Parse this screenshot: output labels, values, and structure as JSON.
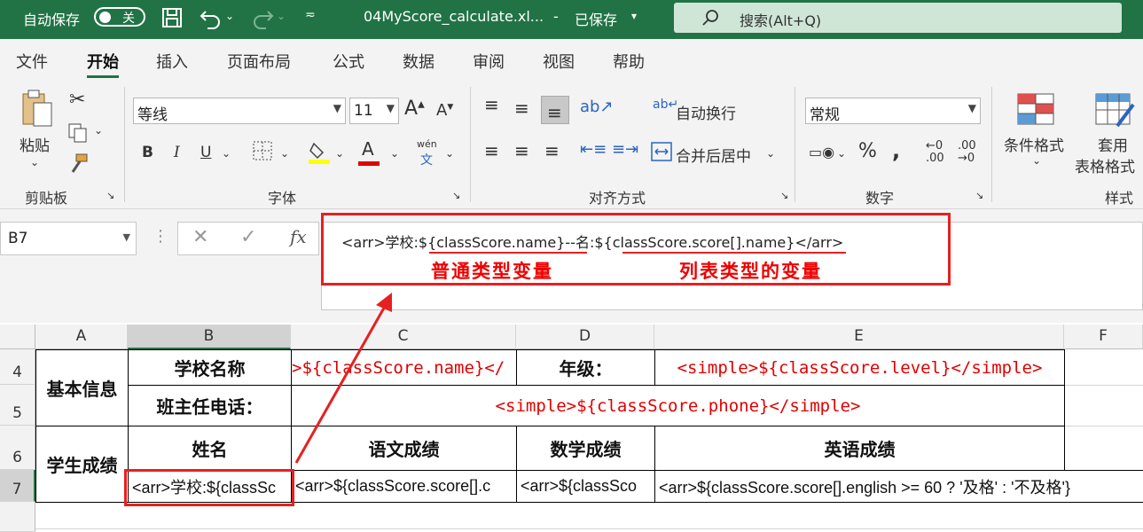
{
  "titlebar": {
    "autosave_label": "自动保存",
    "autosave_state": "关",
    "filename": "04MyScore_calculate.xl...",
    "save_status": "已保存",
    "search_placeholder": "搜索(Alt+Q)"
  },
  "tabs": [
    {
      "label": "文件"
    },
    {
      "label": "开始"
    },
    {
      "label": "插入"
    },
    {
      "label": "页面布局"
    },
    {
      "label": "公式"
    },
    {
      "label": "数据"
    },
    {
      "label": "审阅"
    },
    {
      "label": "视图"
    },
    {
      "label": "帮助"
    }
  ],
  "ribbon": {
    "clipboard": {
      "paste_label": "粘贴",
      "group_title": "剪贴板"
    },
    "font": {
      "font_name": "等线",
      "font_size": "11",
      "group_title": "字体",
      "phonetic_top": "wén",
      "phonetic_bottom": "文"
    },
    "alignment": {
      "wrap_text": "自动换行",
      "merge_center": "合并后居中",
      "group_title": "对齐方式"
    },
    "number": {
      "format": "常规",
      "group_title": "数字",
      "increase_decimal": ".00",
      "decrease_decimal": ".00"
    },
    "styles": {
      "conditional_format": "条件格式",
      "table_format_line1": "套用",
      "table_format_line2": "表格格式",
      "group_title": "样式"
    }
  },
  "formula_bar": {
    "name_box": "B7",
    "content": "<arr>学校:${classScore.name}--名:${classScore.score[].name}</arr>"
  },
  "annotations": {
    "normal_var": "普通类型变量",
    "list_var": "列表类型的变量"
  },
  "columns": [
    "A",
    "B",
    "C",
    "D",
    "E",
    "F"
  ],
  "rows": [
    "4",
    "5",
    "6",
    "7"
  ],
  "cells": {
    "A4": "基本信息",
    "B4": "学校名称",
    "C4": ">${classScore.name}</",
    "D4": "年级：",
    "E4": "<simple>${classScore.level}</simple>",
    "B5": "班主任电话：",
    "C5": "<simple>${classScore.phone}</simple>",
    "A6": "学生成绩",
    "B6": "姓名",
    "C6": "语文成绩",
    "D6": "数学成绩",
    "E6": "英语成绩",
    "B7": "<arr>学校:${classSc",
    "C7": "<arr>${classScore.score[].c",
    "D7": "<arr>${classSco",
    "E7": "<arr>${classScore.score[].english >= 60 ? '及格' : '不及格'}"
  },
  "colors": {
    "excel_green": "#217346",
    "annotation_red": "#e00000"
  }
}
